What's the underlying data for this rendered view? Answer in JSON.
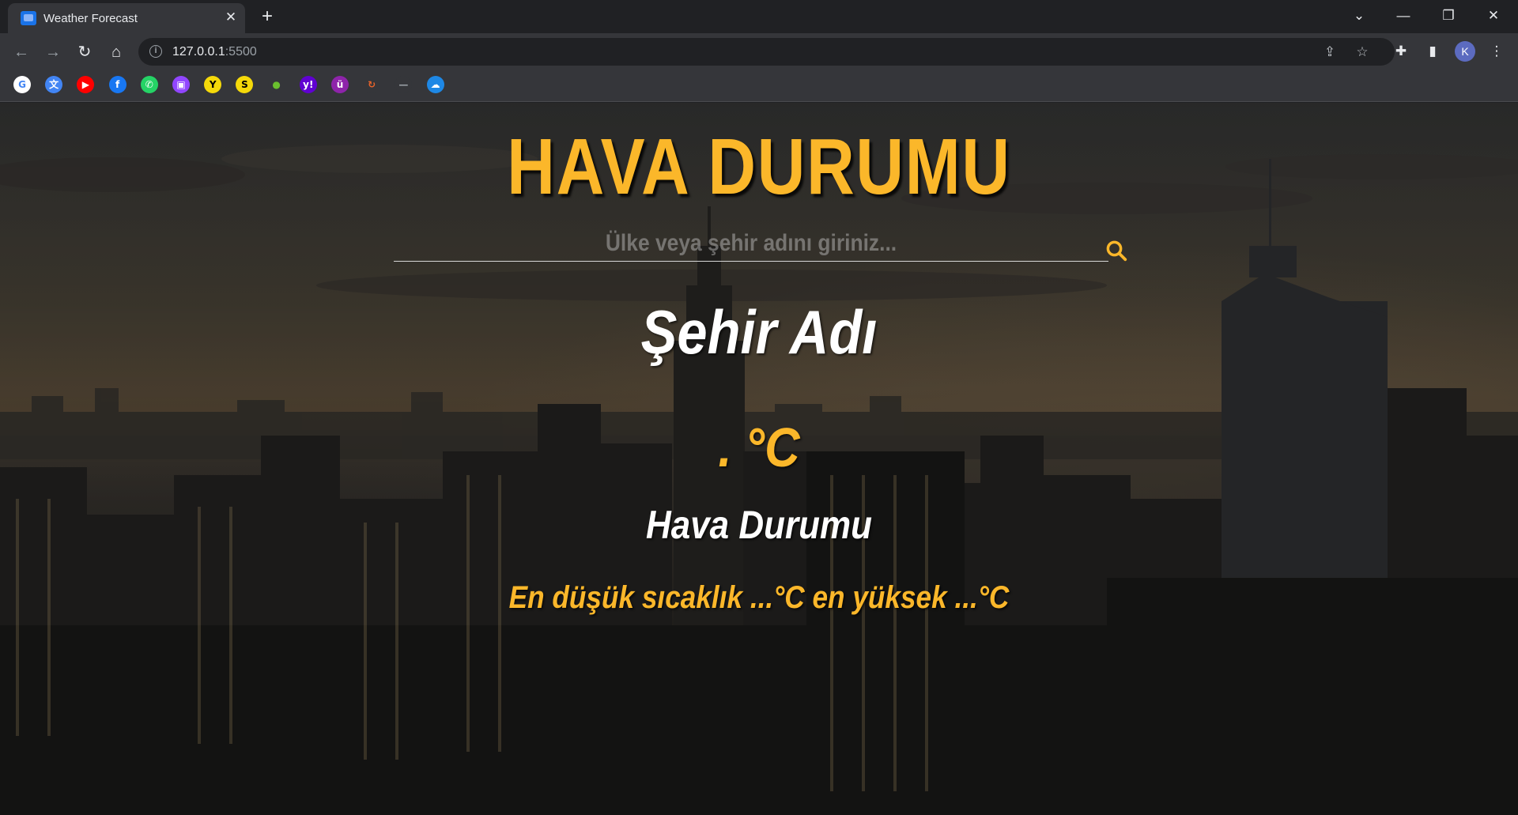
{
  "browser": {
    "tab_title": "Weather Forecast",
    "url_host": "127.0.0.1",
    "url_port": ":5500",
    "profile_initial": "K",
    "bookmarks": [
      {
        "name": "google-bookmark",
        "glyph": "G",
        "color": "#ffffff",
        "fg": "#4285f4"
      },
      {
        "name": "translate-bookmark",
        "glyph": "文",
        "color": "#4285f4",
        "fg": "#ffffff"
      },
      {
        "name": "youtube-bookmark",
        "glyph": "▶",
        "color": "#ff0000",
        "fg": "#ffffff"
      },
      {
        "name": "facebook-bookmark",
        "glyph": "f",
        "color": "#1877f2",
        "fg": "#ffffff"
      },
      {
        "name": "whatsapp-bookmark",
        "glyph": "✆",
        "color": "#25d366",
        "fg": "#ffffff"
      },
      {
        "name": "twitch-bookmark",
        "glyph": "▣",
        "color": "#9146ff",
        "fg": "#ffffff"
      },
      {
        "name": "bookmark-yellow-y",
        "glyph": "Y",
        "color": "#f5d90a",
        "fg": "#000000"
      },
      {
        "name": "bookmark-yellow-s",
        "glyph": "S",
        "color": "#f5d90a",
        "fg": "#000000"
      },
      {
        "name": "bookmark-green-drop",
        "glyph": "●",
        "color": "#35363a",
        "fg": "#6abf2e"
      },
      {
        "name": "yahoo-bookmark",
        "glyph": "y!",
        "color": "#6001d2",
        "fg": "#ffffff"
      },
      {
        "name": "bookmark-purple-u",
        "glyph": "ü",
        "color": "#8e24aa",
        "fg": "#ffffff"
      },
      {
        "name": "bookmark-orange-circle",
        "glyph": "↻",
        "color": "#35363a",
        "fg": "#e8632a"
      },
      {
        "name": "bookmark-dash",
        "glyph": "—",
        "color": "#35363a",
        "fg": "#9aa0a6"
      },
      {
        "name": "bookmark-cloud-upload",
        "glyph": "☁",
        "color": "#1e88e5",
        "fg": "#ffffff"
      }
    ]
  },
  "app": {
    "title": "HAVA DURUMU",
    "search_placeholder": "Ülke veya şehir adını giriniz...",
    "city": "Şehir Adı",
    "temperature": ". °C",
    "description": "Hava Durumu",
    "min_max": "En düşük sıcaklık ...°C en yüksek ...°C",
    "accent_color": "#fbb72a"
  }
}
